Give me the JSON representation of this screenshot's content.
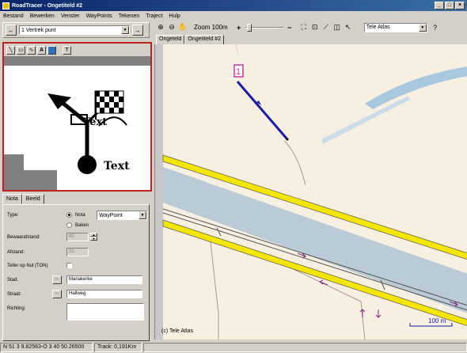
{
  "window": {
    "title": "RoadTracer - Ongetiteld #2",
    "min": "_",
    "max": "□",
    "close": "×"
  },
  "menu": [
    "Bestand",
    "Bewerken",
    "Venster",
    "WayPoints",
    "Tekenen",
    "Traject",
    "Hulp"
  ],
  "waypoint_select": {
    "value": "1 Vertrek punt"
  },
  "toolbar": {
    "zoom_label": "Zoom 100m",
    "provider": "Tele Atlas"
  },
  "map_tabs": [
    "Ongeteld",
    "Ongetiteld #2"
  ],
  "editor": {
    "text_top": "Text",
    "text_bottom": "Text"
  },
  "prop_tabs": [
    "Nota",
    "Beeld"
  ],
  "props": {
    "type_label": "Type:",
    "nota_label": "Nota",
    "baken_label": "Baken",
    "waypoint_type": "WayPoint",
    "bewaar_label": "Bewaarafstand:",
    "bewaar_value": "40",
    "afstand_label": "Afstand:",
    "afstand_value": "31",
    "teller_label": "Teller op Nul (TON)",
    "stad_label": "Stad:",
    "stad_value": "Mariakerke",
    "straat_label": "Straat:",
    "straat_value": "Hallweg",
    "richting_label": "Richting:",
    "dots": "..."
  },
  "map": {
    "marker": "1",
    "copyright": "(c) Tele Atlas",
    "scale": "100 m",
    "colors": {
      "land": "#f7efe0",
      "water": "#b8cbd6",
      "highway": "#f5e600",
      "route": "#1a1aaa",
      "marker": "#cc33aa"
    }
  },
  "status": {
    "coords": "N 51 3 9.82563-O 3 40 50.26500",
    "track": "Track: 0,191Km"
  }
}
